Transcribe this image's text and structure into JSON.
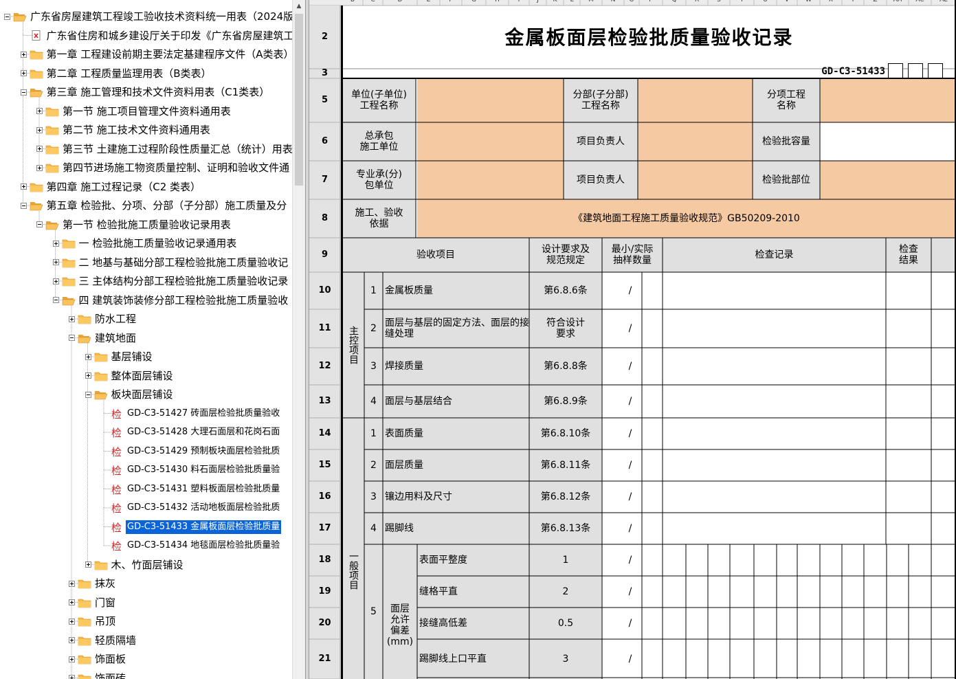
{
  "colors": {
    "highlight": "#f5c9a2",
    "gray": "#e0e0e0",
    "header_gray": "#e3e3e3",
    "selection": "#0a64d8",
    "folder": "#f5a623"
  },
  "tree": {
    "nodes": [
      {
        "text": "广东省房屋建筑工程竣工验收技术资料统一用表（2024版",
        "icon": "folder-open-icon",
        "state": "minus"
      },
      {
        "text": "广东省住房和城乡建设厅关于印发《广东省房屋建筑工",
        "icon": "pdf-icon",
        "state": "none"
      },
      {
        "text": "第一章 工程建设前期主要法定基建程序文件（A类表）",
        "icon": "folder-icon",
        "state": "plus"
      },
      {
        "text": "第二章 工程质量监理用表（B类表）",
        "icon": "folder-icon",
        "state": "plus"
      },
      {
        "text": "第三章 施工管理和技术文件资料用表（C1类表）",
        "icon": "folder-open-icon",
        "state": "minus"
      },
      {
        "text": "第一节 施工项目管理文件资料通用表",
        "icon": "folder-icon",
        "state": "plus"
      },
      {
        "text": "第二节 施工技术文件资料通用表",
        "icon": "folder-icon",
        "state": "plus"
      },
      {
        "text": "第三节 土建施工过程阶段性质量汇总（统计）用表",
        "icon": "folder-icon",
        "state": "plus"
      },
      {
        "text": "第四节进场施工物资质量控制、证明和验收文件通",
        "icon": "folder-icon",
        "state": "plus"
      },
      {
        "text": "第四章 施工过程记录（C2 类表）",
        "icon": "folder-icon",
        "state": "plus"
      },
      {
        "text": "第五章 检验批、分项、分部（子分部）施工质量及分",
        "icon": "folder-open-icon",
        "state": "minus"
      },
      {
        "text": "第一节 检验批施工质量验收记录用表",
        "icon": "folder-open-icon",
        "state": "minus"
      },
      {
        "text": "一 检验批施工质量验收记录通用表",
        "icon": "folder-icon",
        "state": "plus"
      },
      {
        "text": "二 地基与基础分部工程检验批施工质量验收记",
        "icon": "folder-icon",
        "state": "plus"
      },
      {
        "text": "三 主体结构分部工程检验批施工质量验收记录",
        "icon": "folder-icon",
        "state": "plus"
      },
      {
        "text": "四 建筑装饰装修分部工程检验批施工质量验收",
        "icon": "folder-open-icon",
        "state": "minus"
      },
      {
        "text": "防水工程",
        "icon": "folder-icon",
        "state": "plus"
      },
      {
        "text": "建筑地面",
        "icon": "folder-open-icon",
        "state": "minus"
      },
      {
        "text": "基层铺设",
        "icon": "folder-icon",
        "state": "plus"
      },
      {
        "text": "整体面层铺设",
        "icon": "folder-icon",
        "state": "plus"
      },
      {
        "text": "板块面层铺设",
        "icon": "folder-open-icon",
        "state": "minus"
      },
      {
        "text": "GD-C3-51427 砖面层检验批质量验收",
        "icon": "inspection-doc-icon",
        "state": "none"
      },
      {
        "text": "GD-C3-51428 大理石面层和花岗石面",
        "icon": "inspection-doc-icon",
        "state": "none"
      },
      {
        "text": "GD-C3-51429 预制板块面层检验批质",
        "icon": "inspection-doc-icon",
        "state": "none"
      },
      {
        "text": "GD-C3-51430 料石面层检验批质量验",
        "icon": "inspection-doc-icon",
        "state": "none"
      },
      {
        "text": "GD-C3-51431 塑料板面层检验批质量",
        "icon": "inspection-doc-icon",
        "state": "none"
      },
      {
        "text": "GD-C3-51432 活动地板面层检验批质",
        "icon": "inspection-doc-icon",
        "state": "none"
      },
      {
        "text": "GD-C3-51433 金属板面层检验批质量",
        "icon": "inspection-doc-icon",
        "state": "none",
        "selected": true
      },
      {
        "text": "GD-C3-51434 地毯面层检验批质量验",
        "icon": "inspection-doc-icon",
        "state": "none"
      },
      {
        "text": "木、竹面层铺设",
        "icon": "folder-icon",
        "state": "plus"
      },
      {
        "text": "抹灰",
        "icon": "folder-icon",
        "state": "plus"
      },
      {
        "text": "门窗",
        "icon": "folder-icon",
        "state": "plus"
      },
      {
        "text": "吊顶",
        "icon": "folder-icon",
        "state": "plus"
      },
      {
        "text": "轻质隔墙",
        "icon": "folder-icon",
        "state": "plus"
      },
      {
        "text": "饰面板",
        "icon": "folder-icon",
        "state": "plus"
      },
      {
        "text": "饰面砖",
        "icon": "folder-icon",
        "state": "plus"
      }
    ]
  },
  "sheet": {
    "col_headers": [
      "B",
      "C",
      "D",
      "E",
      "F",
      "G",
      "H",
      "I",
      "J",
      "K",
      "L",
      "M",
      "N",
      "O",
      "P",
      "Q",
      "R",
      "S",
      "T",
      "U",
      "V",
      "W",
      "X",
      "Y",
      "Z",
      "AA",
      "AC",
      "AE"
    ],
    "row_numbers": [
      "2",
      "3",
      "5",
      "6",
      "7",
      "8",
      "9",
      "10",
      "11",
      "12",
      "13",
      "14",
      "15",
      "16",
      "17",
      "18",
      "19",
      "20",
      "21"
    ],
    "title": "金属板面层检验批质量验收记录",
    "form_code": "GD-C3-51433",
    "info": {
      "unit_project": "单位(子单位)\n工程名称",
      "division_project": "分部(子分部)\n工程名称",
      "subitem_project": "分项工程\n名称",
      "general_contractor": "总承包\n施工单位",
      "project_leader_1": "项目负责人",
      "batch_capacity": "检验批容量",
      "subcontractor": "专业承(分)\n包单位",
      "project_leader_2": "项目负责人",
      "batch_location": "检验批部位",
      "basis_label": "施工、验收\n依据",
      "basis_value": "《建筑地面工程施工质量验收规范》GB50209-2010"
    },
    "headers": {
      "inspection_item": "验收项目",
      "design_requirement": "设计要求及\n规范规定",
      "sample_count": "最小/实际\n抽样数量",
      "check_record": "检查记录",
      "check_result": "检查\n结果"
    },
    "main_control_label": "主控项目",
    "general_label": "一般项目",
    "main_items": [
      {
        "no": "1",
        "name": "金属板质量",
        "req": "第6.8.6条",
        "slash": "/"
      },
      {
        "no": "2",
        "name": "面层与基层的固定方法、面层的接缝处理",
        "req": "符合设计\n要求",
        "slash": "/"
      },
      {
        "no": "3",
        "name": "焊接质量",
        "req": "第6.8.8条",
        "slash": "/"
      },
      {
        "no": "4",
        "name": "面层与基层结合",
        "req": "第6.8.9条",
        "slash": "/"
      }
    ],
    "general_items": [
      {
        "no": "1",
        "name": "表面质量",
        "req": "第6.8.10条",
        "slash": "/"
      },
      {
        "no": "2",
        "name": "面层质量",
        "req": "第6.8.11条",
        "slash": "/"
      },
      {
        "no": "3",
        "name": "镶边用料及尺寸",
        "req": "第6.8.12条",
        "slash": "/"
      },
      {
        "no": "4",
        "name": "踢脚线",
        "req": "第6.8.13条",
        "slash": "/"
      }
    ],
    "tolerance": {
      "no": "5",
      "label": "面层\n允许\n偏差\n(mm)",
      "items": [
        {
          "name": "表面平整度",
          "req": "1",
          "slash": "/"
        },
        {
          "name": "缝格平直",
          "req": "2",
          "slash": "/"
        },
        {
          "name": "接缝高低差",
          "req": "0.5",
          "slash": "/"
        },
        {
          "name": "踢脚线上口平直",
          "req": "3",
          "slash": "/"
        }
      ]
    }
  }
}
